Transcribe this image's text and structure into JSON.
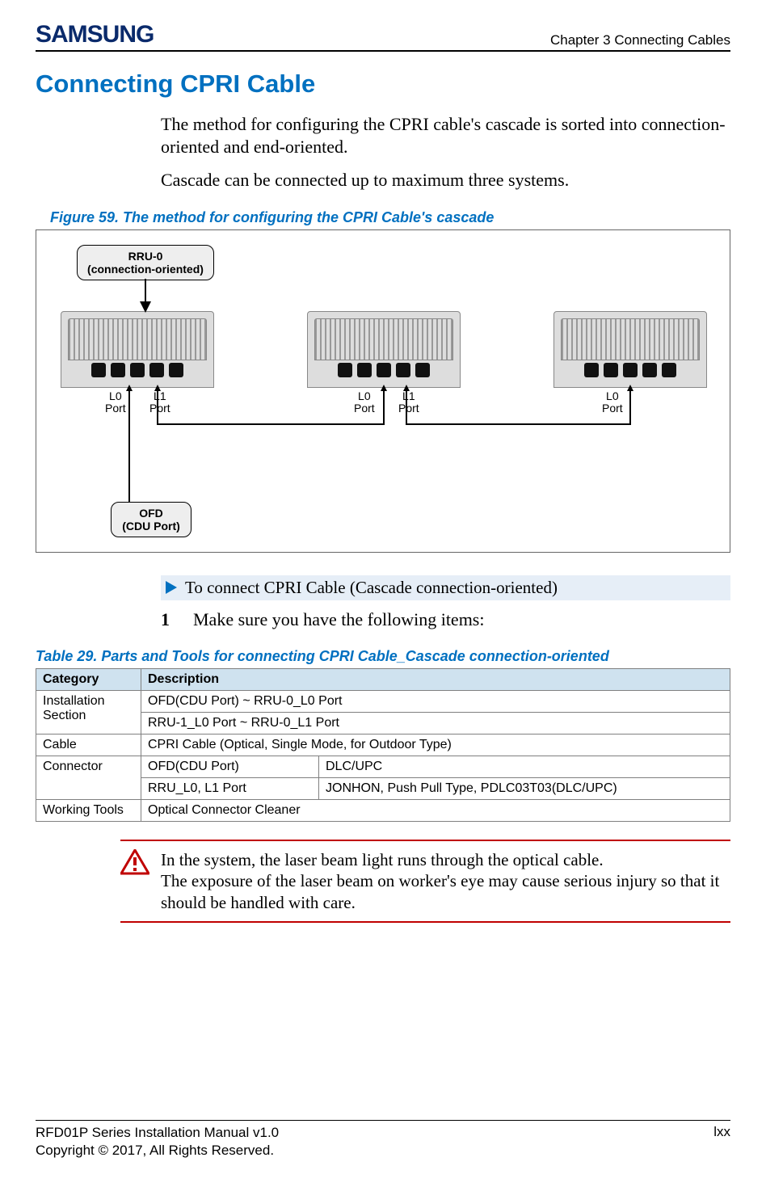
{
  "header": {
    "brand": "SAMSUNG",
    "chapter": "Chapter 3 Connecting Cables"
  },
  "title": "Connecting CPRI Cable",
  "paragraphs": {
    "p1": "The method for configuring the CPRI cable's cascade is sorted into connection-oriented and end-oriented.",
    "p2": "Cascade can be connected up to maximum three systems."
  },
  "figure": {
    "caption": "Figure 59. The method for configuring the CPRI Cable's cascade",
    "rru_label_line1": "RRU-0",
    "rru_label_line2": "(connection-oriented)",
    "ofd_label_line1": "OFD",
    "ofd_label_line2": "(CDU Port)",
    "ports": {
      "l0": "L0",
      "l1": "L1",
      "port": "Port"
    }
  },
  "procedure": {
    "header": "To connect CPRI Cable (Cascade connection-oriented)",
    "step1_num": "1",
    "step1_text": "Make sure you have the following items:"
  },
  "table": {
    "caption": "Table 29. Parts and Tools for connecting CPRI Cable_Cascade connection-oriented",
    "head_category": "Category",
    "head_description": "Description",
    "rows": {
      "inst_section": "Installation Section",
      "inst_r1": "OFD(CDU Port) ~ RRU-0_L0 Port",
      "inst_r2": "RRU-1_L0 Port ~ RRU-0_L1 Port",
      "cable_cat": "Cable",
      "cable_desc": "CPRI Cable (Optical, Single Mode, for Outdoor Type)",
      "conn_cat": "Connector",
      "conn_r1c1": "OFD(CDU Port)",
      "conn_r1c2": "DLC/UPC",
      "conn_r2c1": "RRU_L0, L1 Port",
      "conn_r2c2": "JONHON, Push Pull Type, PDLC03T03(DLC/UPC)",
      "tools_cat": "Working Tools",
      "tools_desc": "Optical Connector Cleaner"
    }
  },
  "warning": {
    "line1": " In the system, the laser beam light runs through the optical cable.",
    "line2": "The exposure of the laser beam on worker's eye may cause serious injury so that it should be handled with care."
  },
  "footer": {
    "manual": "RFD01P Series Installation Manual   v1.0",
    "copyright": "Copyright © 2017, All Rights Reserved.",
    "page": "lxx"
  }
}
